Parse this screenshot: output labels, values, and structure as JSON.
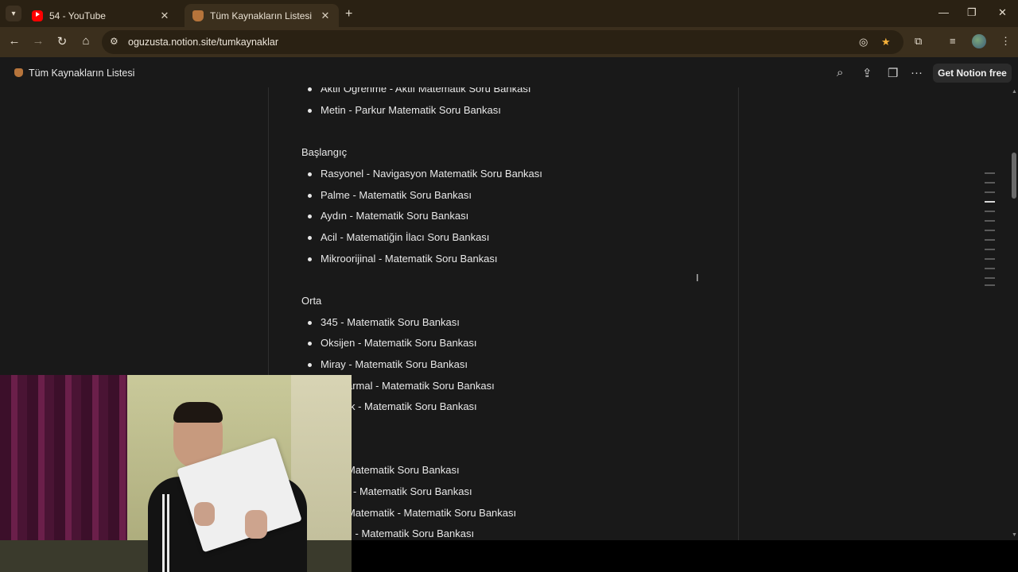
{
  "browser": {
    "tabs": [
      {
        "title": "54 - YouTube",
        "icon": "youtube-icon",
        "active": false
      },
      {
        "title": "Tüm Kaynakların Listesi",
        "icon": "notion-page-icon",
        "active": true
      }
    ],
    "url": "oguzusta.notion.site/tumkaynaklar",
    "colors": {
      "tabstrip": "#2a2113",
      "toolbar": "#3b2f1d",
      "star": "#f7b23b"
    }
  },
  "notion": {
    "page_title": "Tüm Kaynakların Listesi",
    "get_notion_label": "Get Notion free"
  },
  "content": {
    "top_items": [
      "Aktif Öğrenme - Aktif Matematik Soru Bankası",
      "Metin - Parkur Matematik Soru Bankası"
    ],
    "sections": [
      {
        "heading": "Başlangıç",
        "items": [
          "Rasyonel - Navigasyon Matematik Soru Bankası",
          "Palme - Matematik Soru Bankası",
          "Aydın - Matematik Soru Bankası",
          "Acil - Matematiğin İlacı Soru Bankası",
          "Mikroorijinal - Matematik Soru Bankası"
        ]
      },
      {
        "heading": "Orta",
        "items": [
          "345 - Matematik Soru Bankası",
          "Oksijen - Matematik Soru Bankası",
          "Miray - Matematik Soru Bankası",
          "armal - Matematik Soru Bankası",
          "k - Matematik Soru Bankası"
        ]
      }
    ],
    "bottom_items": [
      "Matematik Soru Bankası",
      "- Matematik Soru Bankası",
      "Matematik - Matematik Soru Bankası",
      "l - Matematik Soru Bankası"
    ]
  },
  "webcam": {
    "description_icon": "webcam-overlay"
  }
}
